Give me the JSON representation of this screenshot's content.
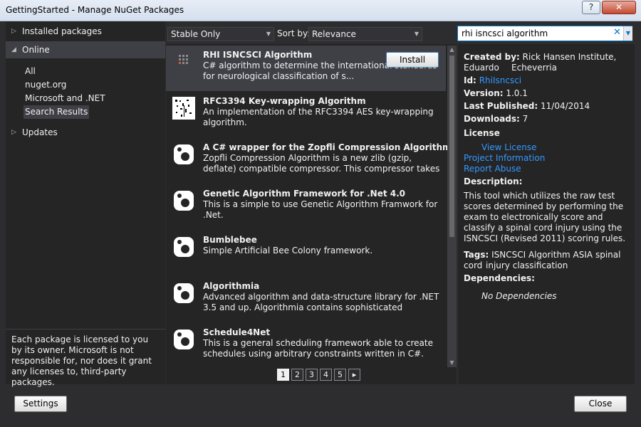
{
  "window": {
    "title": "GettingStarted - Manage NuGet Packages",
    "help_label": "?",
    "close_label": "✕"
  },
  "sidebar": {
    "installed": "Installed packages",
    "online": "Online",
    "online_items": [
      "All",
      "nuget.org",
      "Microsoft and .NET",
      "Search Results"
    ],
    "updates": "Updates",
    "license_note": "Each package is licensed to you by its owner. Microsoft is not responsible for, nor does it grant any licenses to, third-party packages."
  },
  "filters": {
    "stability": "Stable Only",
    "sort_label": "Sort by:",
    "sort_value": "Relevance"
  },
  "search": {
    "value": "rhi isncsci algorithm"
  },
  "packages": [
    {
      "name": "RHI ISNCSCI Algorithm",
      "desc": "C# algorithm to determine the international standards for neurological classification of s..."
    },
    {
      "name": "RFC3394 Key-wrapping Algorithm",
      "desc": "An implementation of the RFC3394 AES key-wrapping algorithm."
    },
    {
      "name": "A C# wrapper for the Zopfli Compression Algorithm",
      "desc": "Zopfli Compression Algorithm is a new zlib (gzip, deflate) compatible compressor. This compressor takes more time (~..."
    },
    {
      "name": "Genetic Algorithm Framework for .Net 4.0",
      "desc": "This is a simple to use Genetic Algorithm Framwork for .Net."
    },
    {
      "name": "Bumblebee",
      "desc": "Simple Artificial Bee Colony framework."
    },
    {
      "name": "Algorithmia",
      "desc": "Advanced algorithm and data-structure library for .NET 3.5 and up. Algorithmia contains sophisticated algorithms and d..."
    },
    {
      "name": "Schedule4Net",
      "desc": "This is a general scheduling framework able to create schedules using arbitrary constraints written in C#."
    }
  ],
  "install_label": "Install",
  "pager": {
    "pages": [
      "1",
      "2",
      "3",
      "4",
      "5"
    ],
    "current": "1",
    "next": "▸"
  },
  "details": {
    "created_by_label": "Created by:",
    "created_by_line1": "Rick Hansen Institute,  Eduardo",
    "created_by_line2": "Echeverria",
    "id_label": "Id:",
    "id_value": "RhiIsncsci",
    "version_label": "Version:",
    "version_value": "1.0.1",
    "published_label": "Last Published:",
    "published_value": "11/04/2014",
    "downloads_label": "Downloads:",
    "downloads_value": "7",
    "license_label": "License",
    "view_license": "View License",
    "project_info": "Project Information",
    "report_abuse": "Report Abuse",
    "description_label": "Description:",
    "description": "This tool which utilizes the raw test scores determined by performing the exam to electronically score and classify a spinal cord injury using the ISNCSCI (Revised 2011) scoring rules.",
    "tags_label": "Tags:",
    "tags_line1": "ISNCSCI Algorithm ASIA spinal cord",
    "tags_line2": "injury classification",
    "dependencies_label": "Dependencies:",
    "dependencies_value": "No Dependencies"
  },
  "footer": {
    "settings": "Settings",
    "close": "Close"
  }
}
